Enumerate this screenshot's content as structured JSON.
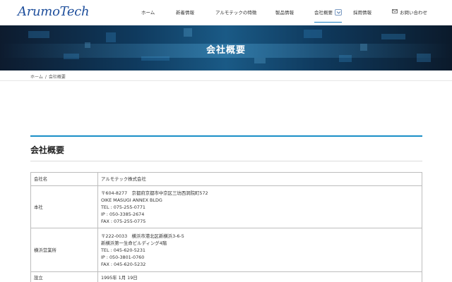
{
  "header": {
    "logo": "ArumoTech",
    "nav": [
      {
        "label": "ホーム"
      },
      {
        "label": "新着情報"
      },
      {
        "label": "アルモテックの特徴"
      },
      {
        "label": "製品情報"
      },
      {
        "label": "会社概要"
      },
      {
        "label": "採用情報"
      },
      {
        "label": "お問い合わせ"
      }
    ]
  },
  "hero": {
    "title": "会社概要"
  },
  "breadcrumb": {
    "home": "ホーム",
    "separator": "/",
    "current": "会社概要"
  },
  "section": {
    "title": "会社概要"
  },
  "company": {
    "rows": [
      {
        "label": "会社名",
        "lines": [
          "アルモテック株式会社"
        ]
      },
      {
        "label": "本社",
        "lines": [
          "〒604-8277　京都府京都市中京区三坊西洞院町572",
          "OIKE MASUGI ANNEX BLDG",
          "TEL : 075-255-0771",
          "IP : 050-3385-2674",
          "FAX : 075-255-0775"
        ]
      },
      {
        "label": "横浜営業所",
        "lines": [
          "〒222-0033　横浜市港北区新横浜3-6-5",
          "新横浜第一生命ビルディング4階",
          "TEL : 045-620-5231",
          "IP : 050-3801-0760",
          "FAX : 045-620-5232"
        ]
      },
      {
        "label": "設立",
        "lines": [
          "1995年 1月 19日"
        ]
      }
    ]
  },
  "colors": {
    "brand": "#1f4f9c",
    "accent": "#1a8fc7"
  },
  "icons": {
    "mail": "mail-icon",
    "chevron": "chevron-down-icon"
  }
}
